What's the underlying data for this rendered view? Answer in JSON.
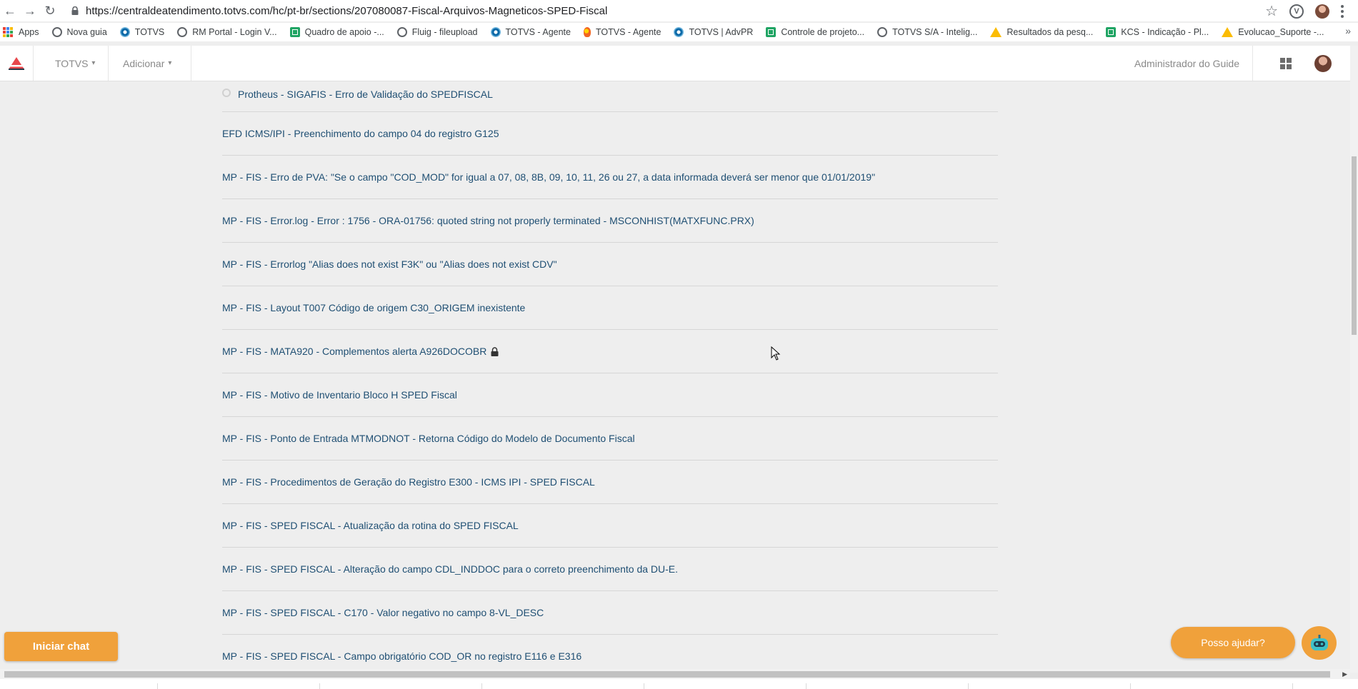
{
  "browser": {
    "url": "https://centraldeatendimento.totvs.com/hc/pt-br/sections/207080087-Fiscal-Arquivos-Magneticos-SPED-Fiscal",
    "bookmarks": [
      {
        "label": "Apps",
        "icon": "apps-grid-icon"
      },
      {
        "label": "Nova guia",
        "icon": "globe-icon"
      },
      {
        "label": "TOTVS",
        "icon": "totvs-icon"
      },
      {
        "label": "RM Portal - Login V...",
        "icon": "globe-icon"
      },
      {
        "label": "Quadro de apoio -...",
        "icon": "sheets-icon"
      },
      {
        "label": "Fluig - fileupload",
        "icon": "globe-icon"
      },
      {
        "label": "TOTVS - Agente",
        "icon": "totvs-icon"
      },
      {
        "label": "TOTVS - Agente",
        "icon": "fluig-icon"
      },
      {
        "label": "TOTVS | AdvPR",
        "icon": "totvs-icon"
      },
      {
        "label": "Controle de projeto...",
        "icon": "sheets-icon"
      },
      {
        "label": "TOTVS S/A - Intelig...",
        "icon": "globe-icon"
      },
      {
        "label": "Resultados da pesq...",
        "icon": "drive-icon"
      },
      {
        "label": "KCS - Indicação - Pl...",
        "icon": "sheets-icon"
      },
      {
        "label": "Evolucao_Suporte -...",
        "icon": "drive-icon"
      }
    ],
    "more_bookmarks": "»"
  },
  "nav": {
    "totvs_menu": "TOTVS",
    "add_menu": "Adicionar",
    "user_name": "Administrador do Guide"
  },
  "articles": [
    "Protheus - SIGAFIS - Erro de Validação do SPEDFISCAL",
    "EFD ICMS/IPI - Preenchimento do campo 04 do registro G125",
    "MP - FIS - Erro de PVA: \"Se o campo \"COD_MOD\" for igual a 07, 08, 8B, 09, 10, 11, 26 ou 27, a data informada deverá ser menor que 01/01/2019\"",
    "MP - FIS - Error.log - Error : 1756 - ORA-01756: quoted string not properly terminated - MSCONHIST(MATXFUNC.PRX)",
    "MP - FIS - Errorlog \"Alias does not exist F3K\" ou \"Alias does not exist CDV\"",
    "MP - FIS - Layout T007 Código de origem C30_ORIGEM inexistente",
    "MP - FIS - MATA920 - Complementos alerta A926DOCOBR",
    "MP - FIS - Motivo de Inventario Bloco H SPED Fiscal",
    "MP - FIS - Ponto de Entrada MTMODNOT - Retorna Código do Modelo de Documento Fiscal",
    "MP - FIS - Procedimentos de Geração do Registro E300 - ICMS IPI - SPED FISCAL",
    "MP - FIS - SPED FISCAL - Atualização da rotina do SPED FISCAL",
    "MP - FIS - SPED FISCAL - Alteração do campo CDL_INDDOC para o correto preenchimento da DU-E.",
    "MP - FIS - SPED FISCAL - C170 - Valor negativo no campo 8-VL_DESC",
    "MP - FIS - SPED FISCAL - Campo obrigatório COD_OR no registro E116 e E316"
  ],
  "chat": {
    "start_label": "Iniciar chat",
    "help_label": "Posso ajudar?"
  },
  "colors": {
    "link": "#1f4f73",
    "accent_orange": "#f0a13b",
    "logo_red": "#e8474c"
  }
}
